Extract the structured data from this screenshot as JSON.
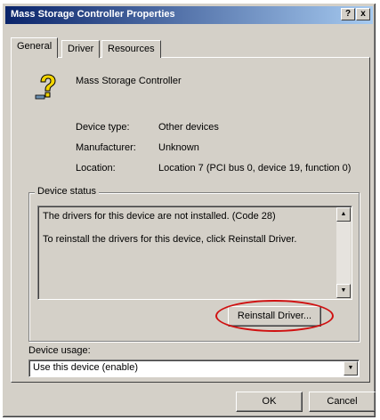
{
  "window": {
    "title": "Mass Storage Controller Properties",
    "help_glyph": "?",
    "close_glyph": "x"
  },
  "tabs": [
    {
      "label": "General",
      "active": true
    },
    {
      "label": "Driver",
      "active": false
    },
    {
      "label": "Resources",
      "active": false
    }
  ],
  "general": {
    "device_name": "Mass Storage Controller",
    "device_icon": "unknown-device-question-icon",
    "properties": [
      {
        "label": "Device type:",
        "value": "Other devices"
      },
      {
        "label": "Manufacturer:",
        "value": "Unknown"
      },
      {
        "label": "Location:",
        "value": "Location 7 (PCI bus 0, device 19, function 0)"
      }
    ],
    "device_status": {
      "title": "Device status",
      "lines": [
        "The drivers for this device are not installed. (Code 28)",
        "To reinstall the drivers for this device, click Reinstall Driver."
      ],
      "scroll_up_glyph": "▲",
      "scroll_down_glyph": "▼"
    },
    "reinstall_button": "Reinstall Driver...",
    "highlight_color": "#d01010",
    "device_usage": {
      "label": "Device usage:",
      "value": "Use this device (enable)",
      "dropdown_glyph": "▼"
    }
  },
  "buttons": {
    "ok": "OK",
    "cancel": "Cancel"
  }
}
